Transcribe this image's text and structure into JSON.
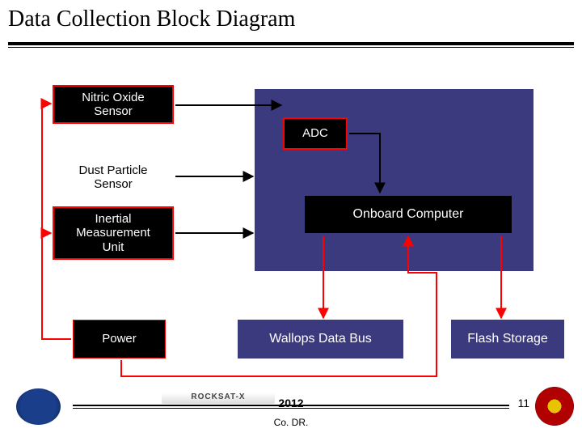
{
  "title": "Data Collection Block Diagram",
  "blocks": {
    "nitric": "Nitric Oxide\nSensor",
    "dust": "Dust Particle\nSensor",
    "imu": "Inertial\nMeasurement\nUnit",
    "power": "Power",
    "adc": "ADC",
    "onboard": "Onboard Computer",
    "wallops": "Wallops Data Bus",
    "flash": "Flash Storage"
  },
  "colors": {
    "panel": "#3c3a7f",
    "block_bg": "#000000",
    "block_fg": "#ffffff",
    "accent_red": "#ff0000",
    "arrow_black": "#000000"
  },
  "connections": [
    {
      "from": "nitric",
      "to": "adc",
      "color": "black"
    },
    {
      "from": "adc",
      "to": "onboard",
      "color": "black"
    },
    {
      "from": "dust",
      "to": "onboard",
      "color": "black"
    },
    {
      "from": "imu",
      "to": "onboard",
      "color": "black"
    },
    {
      "from": "onboard",
      "to": "wallops",
      "color": "red"
    },
    {
      "from": "onboard",
      "to": "flash",
      "color": "red"
    },
    {
      "from": "power",
      "to": "nitric",
      "color": "red"
    },
    {
      "from": "power",
      "to": "imu",
      "color": "red"
    },
    {
      "from": "power",
      "to": "onboard",
      "color": "red"
    }
  ],
  "footer": {
    "program": "ROCKSAT-X",
    "year": "2012",
    "sub": "Co. DR.",
    "page": "11"
  }
}
